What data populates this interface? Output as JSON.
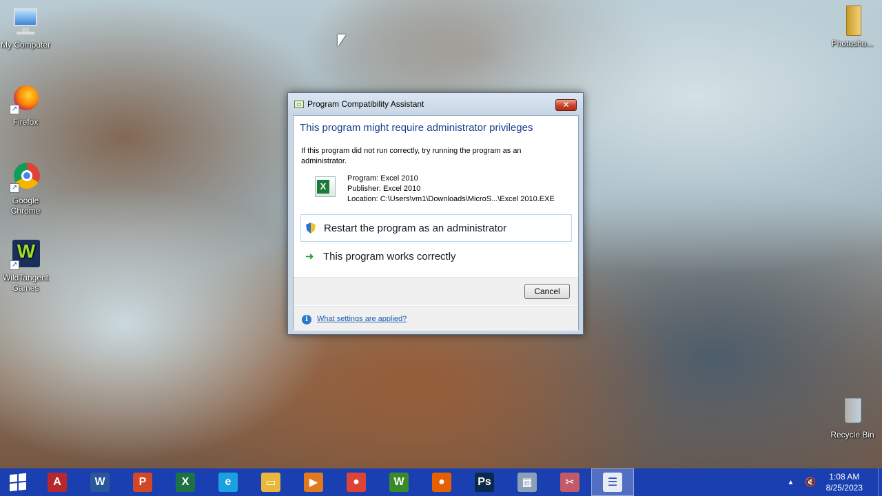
{
  "desktop": {
    "icons_left": [
      {
        "name": "my-computer",
        "label": "My Computer",
        "icon": "monitor-icon"
      },
      {
        "name": "firefox",
        "label": "Firefox",
        "icon": "firefox-icon"
      },
      {
        "name": "google-chrome",
        "label": "Google Chrome",
        "icon": "chrome-icon"
      },
      {
        "name": "wildtangent",
        "label": "WildTangent Games",
        "icon": "wildtangent-icon"
      }
    ],
    "folder": {
      "label": "Photosho...",
      "icon": "folder-icon"
    },
    "recycle": {
      "label": "Recycle Bin",
      "icon": "recycle-bin-icon"
    }
  },
  "dialog": {
    "title": "Program Compatibility Assistant",
    "close_symbol": "✕",
    "heading": "This program might require administrator privileges",
    "description": "If this program did not run correctly, try running the program as an administrator.",
    "program": "Program: Excel 2010",
    "publisher": "Publisher: Excel 2010",
    "location": "Location: C:\\Users\\vm1\\Downloads\\MicroS...\\Excel 2010.EXE",
    "option_restart": "Restart the program as an administrator",
    "option_works": "This program works correctly",
    "cancel": "Cancel",
    "settings_link": "What settings are applied?"
  },
  "taskbar": {
    "apps": [
      {
        "name": "access",
        "icon": "access-icon",
        "color": "#b7282e",
        "glyph": "A"
      },
      {
        "name": "word",
        "icon": "word-icon",
        "color": "#2b579a",
        "glyph": "W"
      },
      {
        "name": "powerpoint",
        "icon": "powerpoint-icon",
        "color": "#d24726",
        "glyph": "P"
      },
      {
        "name": "excel",
        "icon": "excel-icon",
        "color": "#1e7145",
        "glyph": "X"
      },
      {
        "name": "internet-explorer",
        "icon": "ie-icon",
        "color": "#1ba1e2",
        "glyph": "e"
      },
      {
        "name": "file-explorer",
        "icon": "folder-icon",
        "color": "#e8b83a",
        "glyph": "▭"
      },
      {
        "name": "media-player",
        "icon": "media-player-icon",
        "color": "#e07a1f",
        "glyph": "▶"
      },
      {
        "name": "chrome",
        "icon": "chrome-icon",
        "color": "#db4437",
        "glyph": "●"
      },
      {
        "name": "wildtangent",
        "icon": "wildtangent-icon",
        "color": "#3a8a2a",
        "glyph": "W"
      },
      {
        "name": "firefox",
        "icon": "firefox-icon",
        "color": "#e66000",
        "glyph": "●"
      },
      {
        "name": "photoshop",
        "icon": "photoshop-icon",
        "color": "#0b2a4a",
        "glyph": "Ps"
      },
      {
        "name": "setup",
        "icon": "installer-icon",
        "color": "#8aa0b8",
        "glyph": "▦"
      },
      {
        "name": "snipping-tool",
        "icon": "scissors-icon",
        "color": "#c25a6a",
        "glyph": "✂"
      },
      {
        "name": "compatibility-assistant",
        "icon": "list-window-icon",
        "color": "#e6edf5",
        "glyph": "☰"
      }
    ],
    "time": "1:08 AM",
    "date": "8/25/2023"
  }
}
